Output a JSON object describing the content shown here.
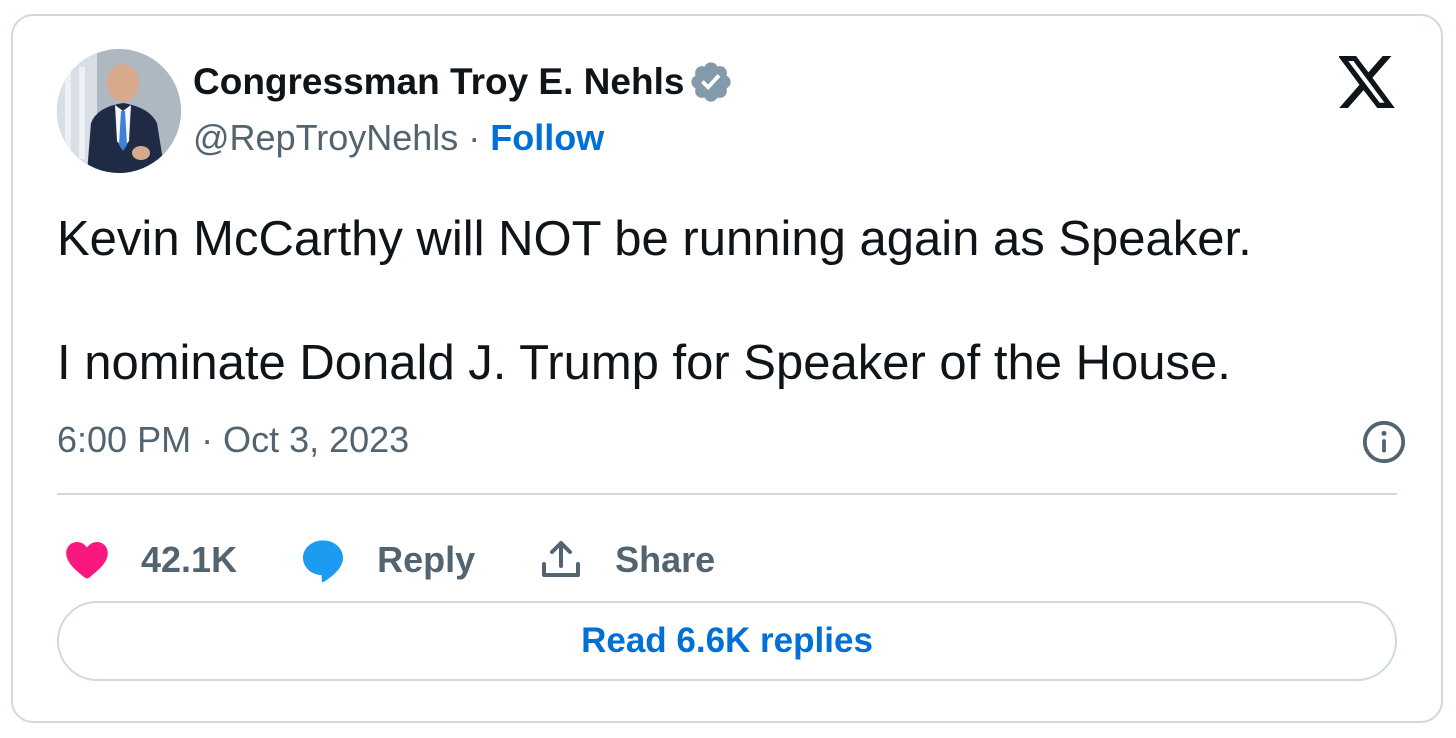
{
  "author": {
    "display_name": "Congressman Troy E. Nehls",
    "handle": "@RepTroyNehls",
    "separator": "·",
    "follow_label": "Follow",
    "verified": true
  },
  "tweet": {
    "paragraphs": [
      "Kevin McCarthy will NOT be running again as Speaker.",
      "I nominate Donald J. Trump for Speaker of the House."
    ],
    "timestamp": "6:00 PM · Oct 3, 2023"
  },
  "actions": {
    "like": {
      "icon": "heart-icon",
      "count": "42.1K"
    },
    "reply": {
      "icon": "speech-bubble-icon",
      "label": "Reply"
    },
    "share": {
      "icon": "share-upload-icon",
      "label": "Share"
    }
  },
  "read_replies_label": "Read 6.6K replies",
  "icons": {
    "brand": "x-logo-icon",
    "info": "info-icon",
    "verified": "verified-badge-icon"
  },
  "colors": {
    "link": "#006fd6",
    "text": "#0f1419",
    "muted": "#536471",
    "border": "#cfd9de",
    "heart": "#f91880",
    "reply_bubble": "#1d9bf0"
  }
}
